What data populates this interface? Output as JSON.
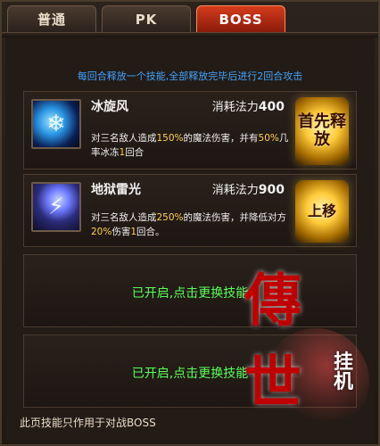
{
  "tabs": [
    {
      "label": "普通"
    },
    {
      "label": "PK"
    },
    {
      "label": "BOSS"
    }
  ],
  "info_text": "每回合释放一个技能,全部释放完毕后进行2回合攻击",
  "skills": [
    {
      "name": "冰旋风",
      "cost_prefix": "消耗法力",
      "cost_value": "400",
      "desc_parts": [
        "对三名敌人造成",
        "150%",
        "的魔法伤害，并有",
        "50%",
        "几率冰冻",
        "1",
        "回合"
      ],
      "badge": "首先释放",
      "icon": "ice-whirlwind-icon"
    },
    {
      "name": "地狱雷光",
      "cost_prefix": "消耗法力",
      "cost_value": "900",
      "desc_parts": [
        "对三名敌人造成",
        "250%",
        "的魔法伤害，并降低对方",
        "20%",
        "伤害",
        "1",
        "回合。"
      ],
      "badge": "上移",
      "icon": "hell-lightning-icon"
    }
  ],
  "empty_slots": [
    {
      "text": "已开启,点击更换技能"
    },
    {
      "text": "已开启,点击更换技能"
    }
  ],
  "footer_text": "此页技能只作用于对战BOSS",
  "logo": {
    "main": "傳世",
    "sub": "挂机"
  }
}
